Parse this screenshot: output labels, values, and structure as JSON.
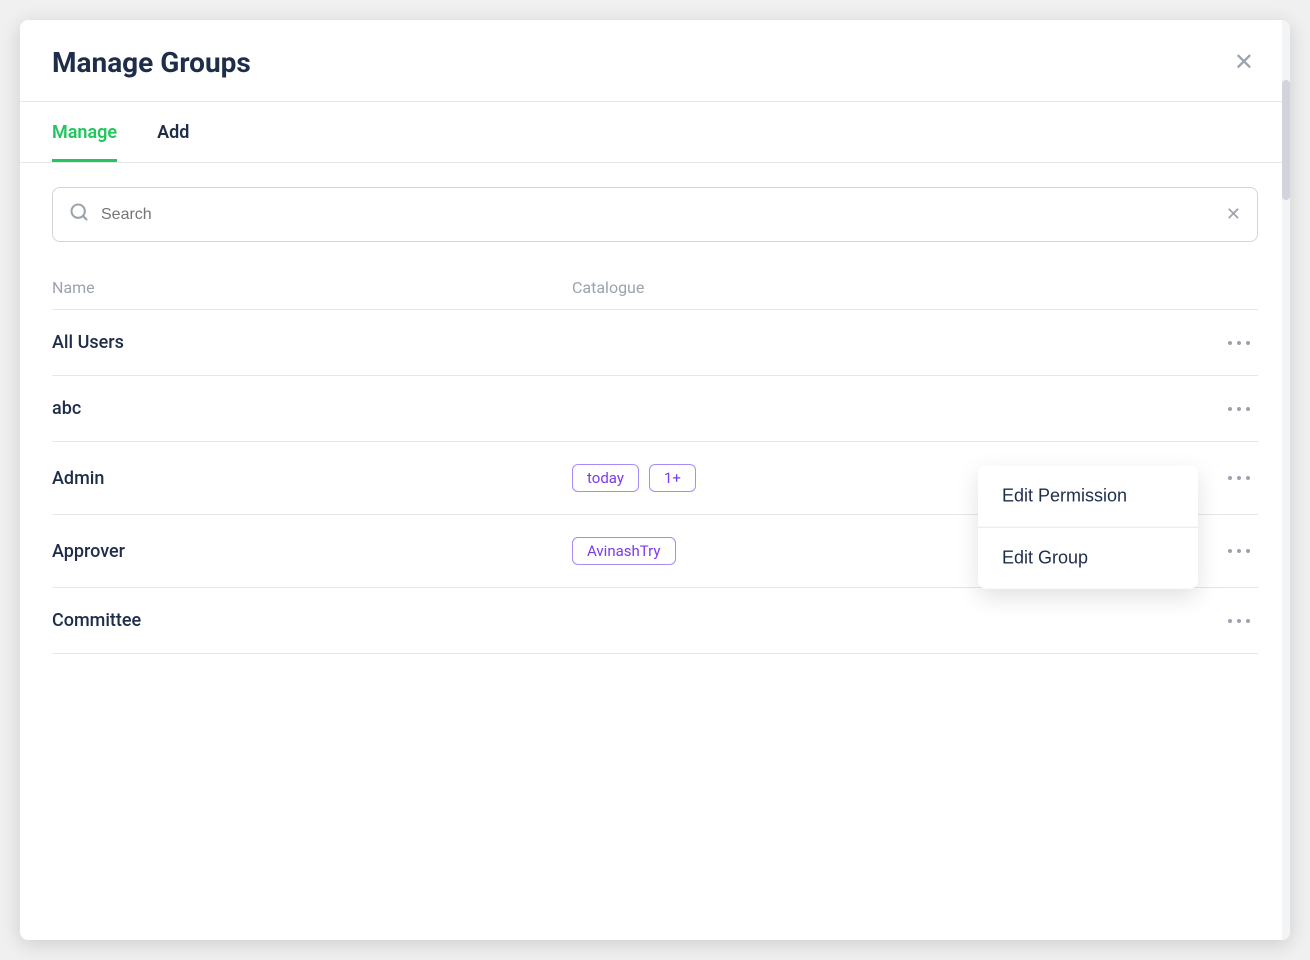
{
  "modal": {
    "title": "Manage Groups",
    "close_label": "✕"
  },
  "tabs": [
    {
      "id": "manage",
      "label": "Manage",
      "active": true
    },
    {
      "id": "add",
      "label": "Add",
      "active": false
    }
  ],
  "search": {
    "placeholder": "Search",
    "value": "",
    "clear_label": "✕"
  },
  "table": {
    "headers": {
      "name": "Name",
      "catalogue": "Catalogue"
    },
    "rows": [
      {
        "id": "all-users",
        "name": "All Users",
        "tags": [],
        "show_dropdown": false
      },
      {
        "id": "abc",
        "name": "abc",
        "tags": [],
        "show_dropdown": false
      },
      {
        "id": "admin",
        "name": "Admin",
        "tags": [
          "today",
          "1+"
        ],
        "show_dropdown": true
      },
      {
        "id": "approver",
        "name": "Approver",
        "tags": [
          "AvinashTry"
        ],
        "show_dropdown": false
      },
      {
        "id": "committee",
        "name": "Committee",
        "tags": [],
        "show_dropdown": false
      }
    ]
  },
  "dropdown": {
    "edit_permission_label": "Edit Permission",
    "edit_group_label": "Edit Group"
  },
  "icons": {
    "search": "🔍",
    "more": "···",
    "close": "✕"
  }
}
